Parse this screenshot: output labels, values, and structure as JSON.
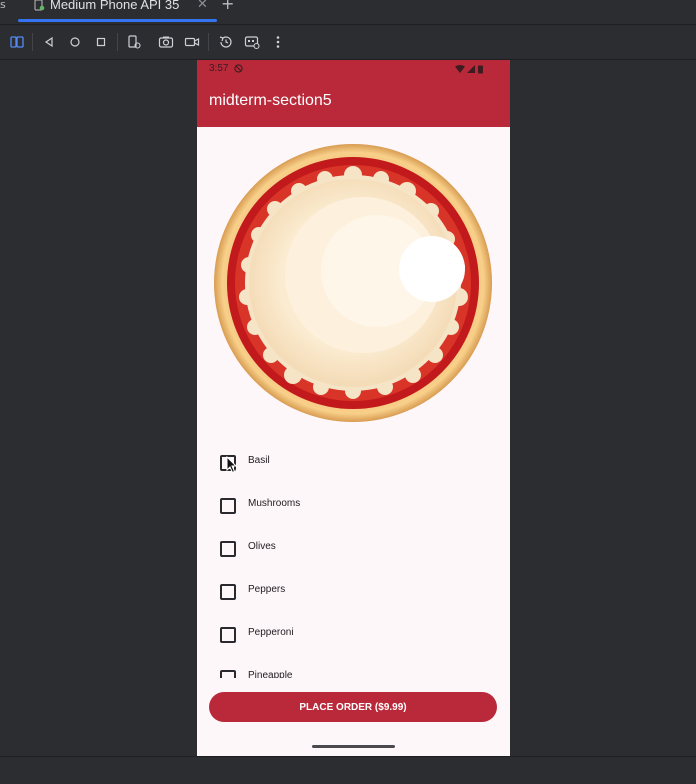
{
  "ide": {
    "tab": {
      "label": "Medium Phone API 35",
      "close_glyph": "✕",
      "icon": "device-icon"
    },
    "new_tab_glyph": "+",
    "accent": "#3574f0"
  },
  "toolbar": {
    "icons": [
      "device-frame-icon",
      "back-icon",
      "home-icon",
      "overview-icon",
      "rotate-device-icon",
      "screenshot-icon",
      "screen-record-icon",
      "snapshot-icon",
      "extended-controls-icon",
      "more-icon"
    ]
  },
  "phone": {
    "status_bar": {
      "time": "3:57"
    },
    "app_title": "midterm-section5",
    "brand_color": "#b9293a",
    "toppings": [
      {
        "label": "Basil",
        "checked": false
      },
      {
        "label": "Mushrooms",
        "checked": false
      },
      {
        "label": "Olives",
        "checked": false
      },
      {
        "label": "Peppers",
        "checked": false
      },
      {
        "label": "Pepperoni",
        "checked": false
      },
      {
        "label": "Pineapple",
        "checked": false
      }
    ],
    "order_button": "PLACE ORDER ($9.99)"
  }
}
